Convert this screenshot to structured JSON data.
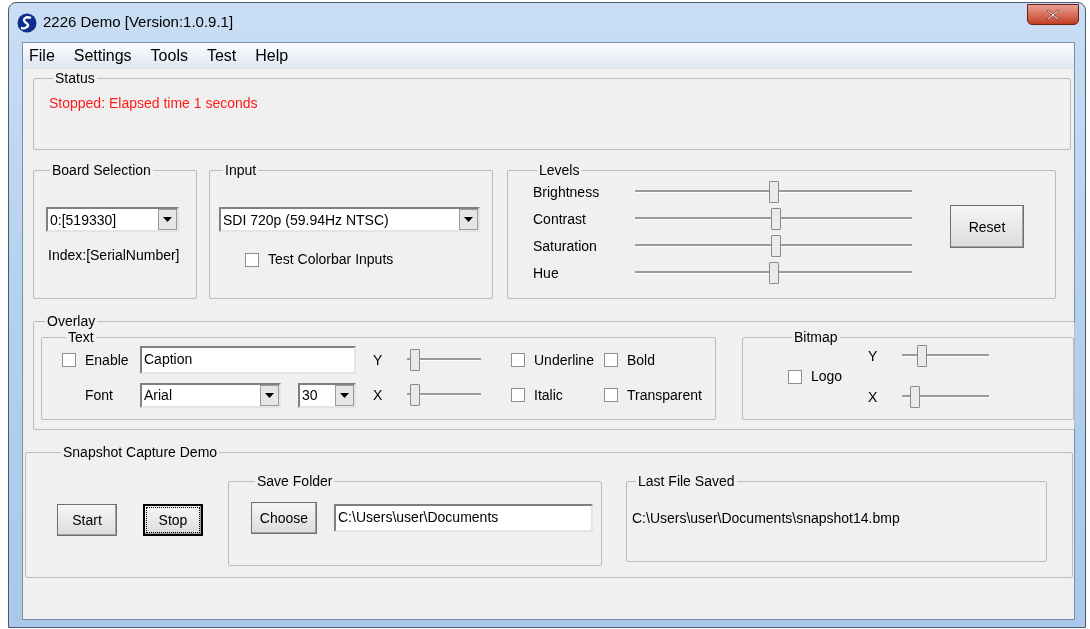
{
  "window": {
    "title": "2226 Demo [Version:1.0.9.1]"
  },
  "menu": [
    {
      "label": "File"
    },
    {
      "label": "Settings"
    },
    {
      "label": "Tools"
    },
    {
      "label": "Test"
    },
    {
      "label": "Help"
    }
  ],
  "status": {
    "title": "Status",
    "message": "Stopped: Elapsed time 1 seconds"
  },
  "board_selection": {
    "title": "Board Selection",
    "value": "0:[519330]",
    "caption": "Index:[SerialNumber]"
  },
  "input": {
    "title": "Input",
    "value": "SDI 720p (59.94Hz NTSC)",
    "checkbox": {
      "label": "Test Colorbar Inputs",
      "checked": false
    }
  },
  "levels": {
    "title": "Levels",
    "sliders": [
      {
        "label": "Brightness",
        "level": 0.5
      },
      {
        "label": "Contrast",
        "level": 0.51
      },
      {
        "label": "Saturation",
        "level": 0.51
      },
      {
        "label": "Hue",
        "level": 0.5
      }
    ],
    "reset_button": "Reset"
  },
  "overlay": {
    "title": "Overlay",
    "text": {
      "title": "Text",
      "enable": {
        "label": "Enable",
        "checked": false
      },
      "caption": "Caption",
      "font_label": "Font",
      "font": "Arial",
      "size": "30",
      "sliders": [
        {
          "label": "Y",
          "level": 0.05
        },
        {
          "label": "X",
          "level": 0.05
        }
      ],
      "options": [
        {
          "label": "Underline",
          "checked": false
        },
        {
          "label": "Bold",
          "checked": false
        },
        {
          "label": "Italic",
          "checked": false
        },
        {
          "label": "Transparent",
          "checked": false
        }
      ]
    },
    "bitmap": {
      "title": "Bitmap",
      "logo": {
        "label": "Logo",
        "checked": false
      },
      "sliders": [
        {
          "label": "Y",
          "level": 0.2
        },
        {
          "label": "X",
          "level": 0.1
        }
      ]
    }
  },
  "snapshot": {
    "title": "Snapshot Capture Demo",
    "buttons": [
      {
        "label": "Start",
        "focused": false
      },
      {
        "label": "Stop",
        "focused": true
      }
    ],
    "save_folder": {
      "title": "Save Folder",
      "button": "Choose",
      "path": "C:\\Users\\user\\Documents"
    },
    "last_file": {
      "title": "Last File Saved",
      "path": "C:\\Users\\user\\Documents\\snapshot14.bmp"
    }
  }
}
